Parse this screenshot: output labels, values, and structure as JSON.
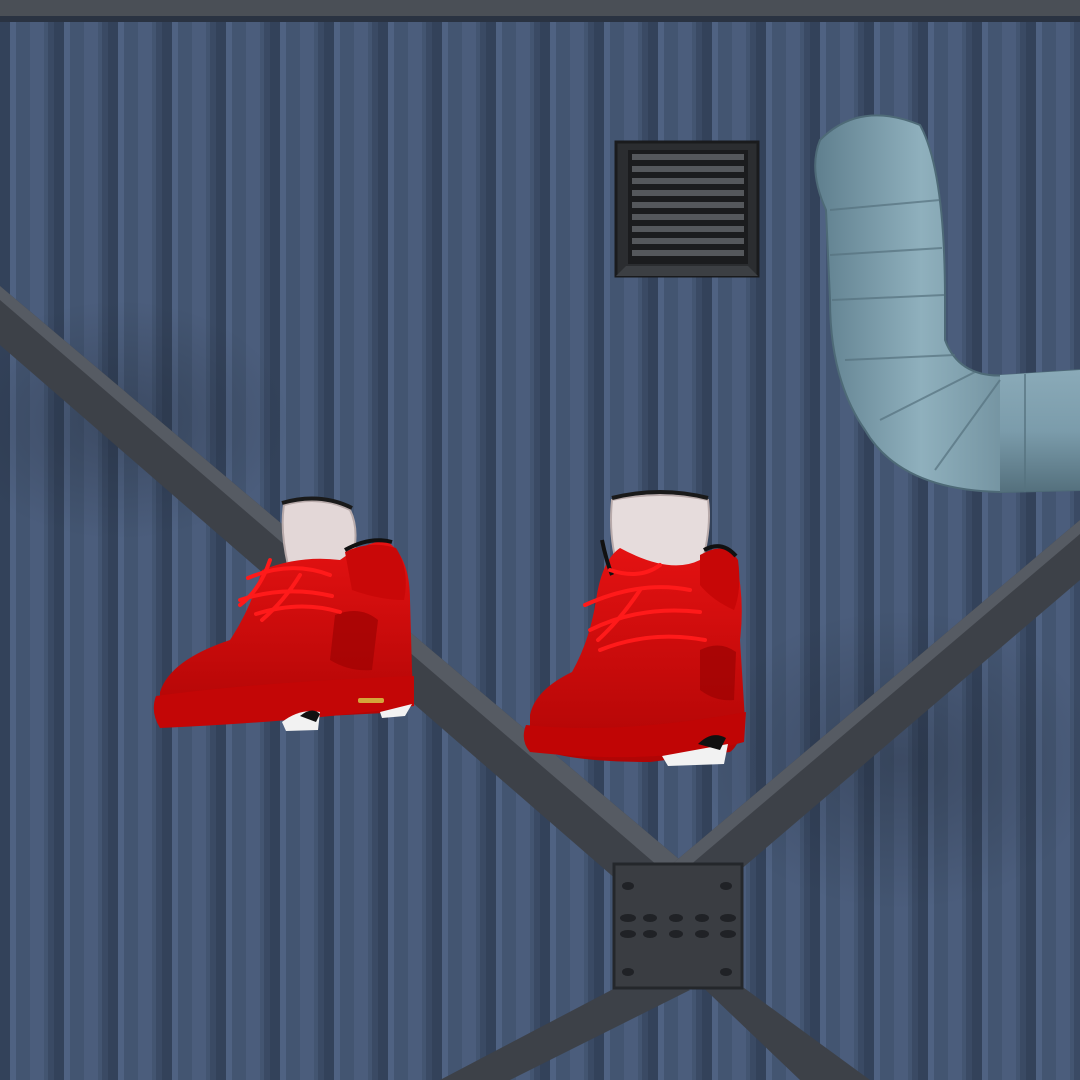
{
  "scene": {
    "subject": "red-suede-sneakers",
    "backdrop": "corrugated-metal-wall",
    "colors": {
      "wall": "#435571",
      "wall_dark": "#2f3d52",
      "wall_light": "#56698a",
      "beam": "#3e4249",
      "plate": "#3a3d42",
      "pipe": "#7f9fae",
      "shoe_red": "#d80b0b",
      "shoe_dark": "#8e0303",
      "sock": "#e6dcdc",
      "sole_white": "#f2f2f2"
    }
  },
  "icons": [
    "wall-vent-icon",
    "steel-gusset-plate-icon"
  ]
}
